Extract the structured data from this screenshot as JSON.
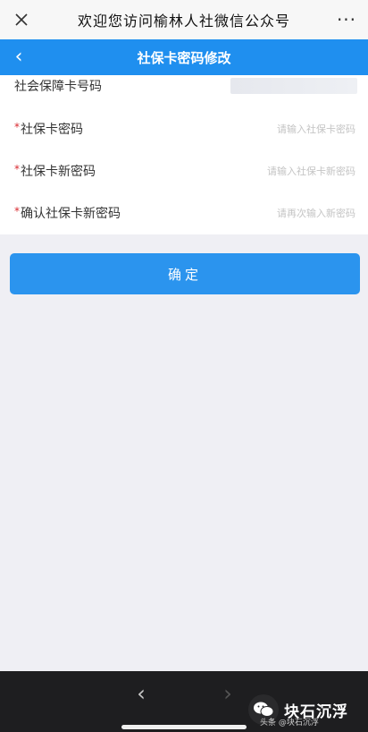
{
  "wechat_bar": {
    "title": "欢迎您访问榆林人社微信公众号",
    "close_icon": "close-icon",
    "more_label": "···"
  },
  "header": {
    "back_icon": "chevron-left-icon",
    "back_glyph": "‹",
    "title": "社保卡密码修改"
  },
  "form": {
    "rows": [
      {
        "label": "社会保障卡号码",
        "required": false,
        "value": "",
        "placeholder": ""
      },
      {
        "label": "社保卡密码",
        "required": true,
        "placeholder": "请输入社保卡密码"
      },
      {
        "label": "社保卡新密码",
        "required": true,
        "placeholder": "请输入社保卡新密码"
      },
      {
        "label": "确认社保卡新密码",
        "required": true,
        "placeholder": "请再次输入新密码"
      }
    ],
    "required_mark": "*"
  },
  "confirm_button": {
    "label": "确定"
  },
  "bottom_nav": {
    "back_glyph": "‹",
    "forward_glyph": "›"
  },
  "watermark": {
    "brand": "头条",
    "main": "块石沉浮",
    "sub": "@块石沉浮"
  },
  "colors": {
    "accent": "#1f8fef",
    "button": "#2b94ee",
    "required": "#d8292f",
    "page_bg": "#efeff4",
    "bottom_bar": "#1e1e20"
  }
}
